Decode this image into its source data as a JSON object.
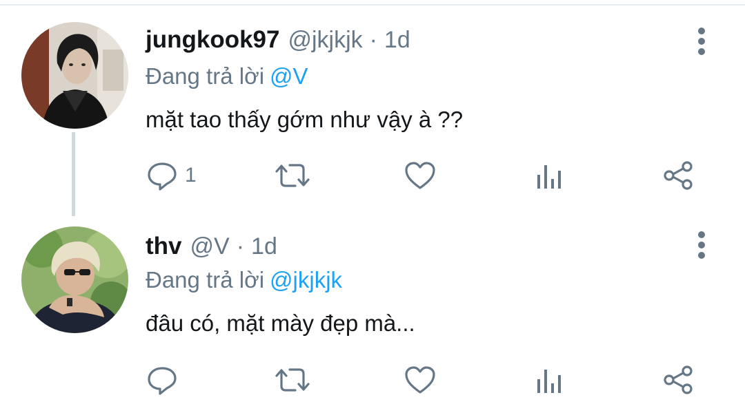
{
  "thread": {
    "tweets": [
      {
        "display_name": "jungkook97",
        "handle": "@jkjkjk",
        "separator": "·",
        "time": "1d",
        "reply_prefix": "Đang trả lời",
        "reply_to": "@V",
        "text": "mặt tao thấy gớm như vậy à ??",
        "actions": {
          "reply_count": "1",
          "icons": [
            "reply-icon",
            "retweet-icon",
            "like-icon",
            "analytics-icon",
            "share-icon"
          ]
        }
      },
      {
        "display_name": "thv",
        "handle": "@V",
        "separator": "·",
        "time": "1d",
        "reply_prefix": "Đang trả lời",
        "reply_to": "@jkjkjk",
        "text": "đâu có, mặt mày đẹp mà...",
        "actions": {
          "reply_count": "",
          "icons": [
            "reply-icon",
            "retweet-icon",
            "like-icon",
            "analytics-icon",
            "share-icon"
          ]
        }
      }
    ]
  },
  "colors": {
    "text": "#14171a",
    "secondary": "#657786",
    "link": "#1da1f2",
    "thread_line": "#cfd9de",
    "divider": "#e6ecf0"
  }
}
